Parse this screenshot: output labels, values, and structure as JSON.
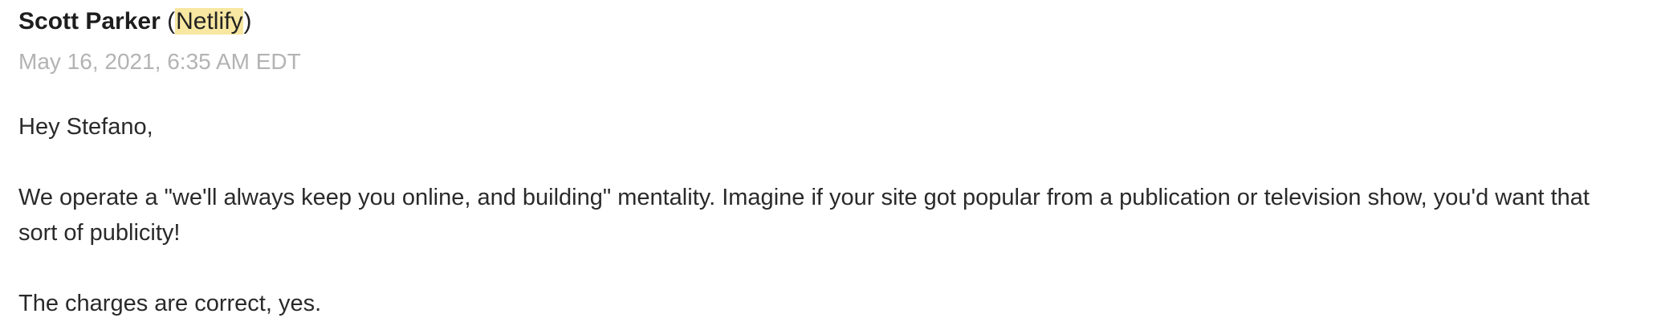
{
  "message": {
    "sender_name": "Scott Parker",
    "open_paren": "(",
    "company": "Netlify",
    "close_paren": ")",
    "timestamp": "May 16, 2021, 6:35 AM EDT",
    "highlight_color": "#f7e7a1",
    "paragraphs": [
      "Hey Stefano,",
      "We operate a \"we'll always keep you online, and building\" mentality. Imagine if your site got popular from a publication or television show, you'd want that sort of publicity!",
      "The charges are correct, yes."
    ]
  }
}
